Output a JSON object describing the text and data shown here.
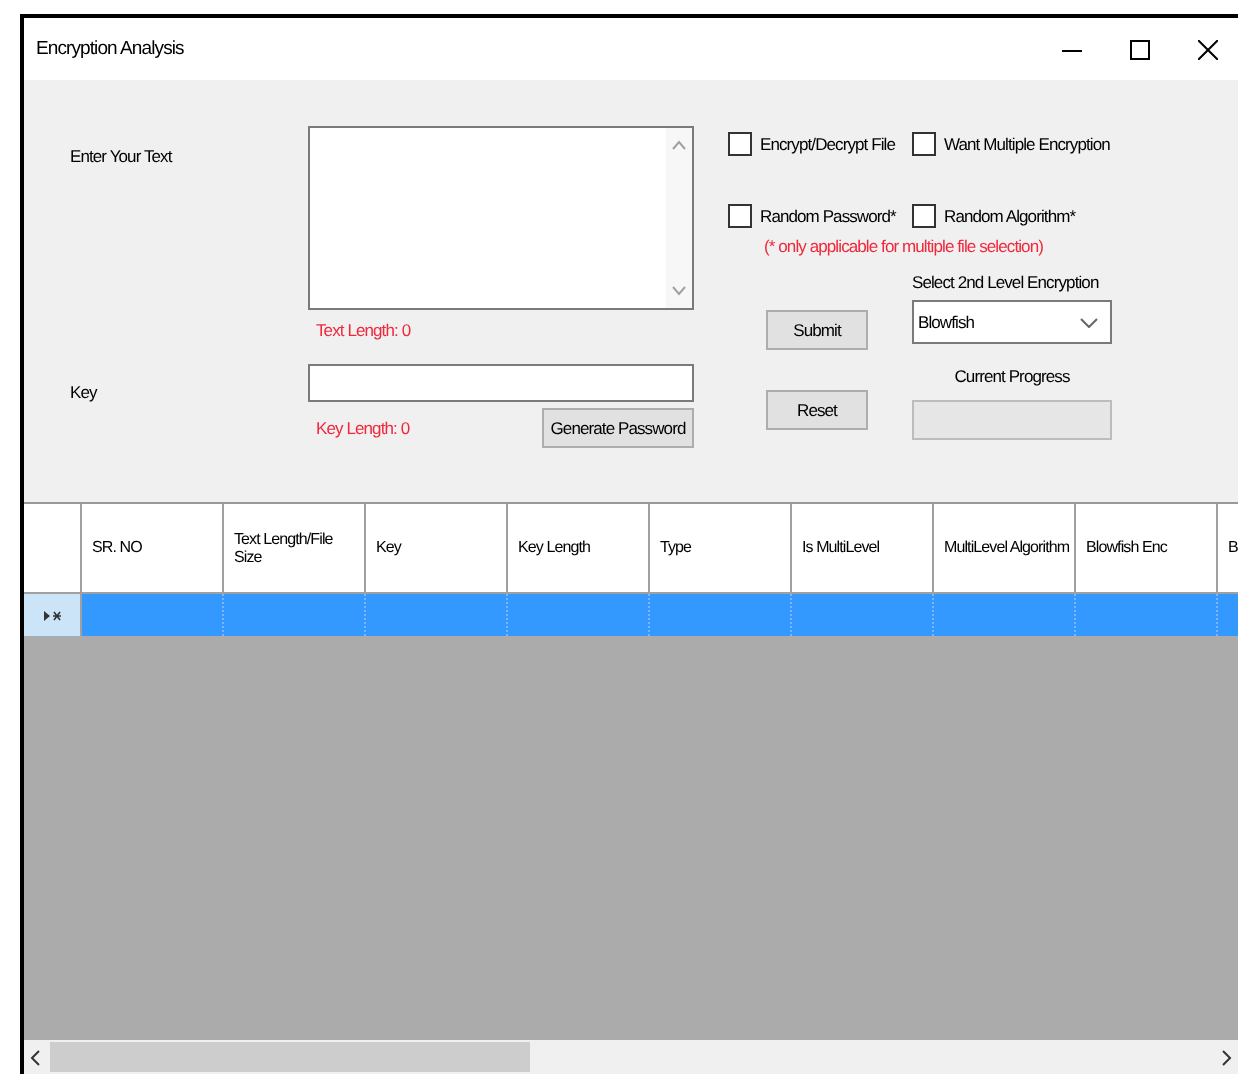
{
  "window": {
    "title": "Encryption Analysis"
  },
  "form": {
    "text_label": "Enter Your Text",
    "text_length": "Text Length: 0",
    "key_label": "Key",
    "key_length": "Key Length: 0",
    "generate_button": "Generate Password",
    "checkboxes": [
      {
        "label": "Encrypt/Decrypt File",
        "checked": false
      },
      {
        "label": "Want Multiple Encryption",
        "checked": false
      },
      {
        "label": "Random Password*",
        "checked": false
      },
      {
        "label": "Random Algorithm*",
        "checked": false
      }
    ],
    "note": "(* only applicable for multiple file selection)",
    "select_label": "Select 2nd Level Encryption",
    "select_value": "Blowfish",
    "submit_button": "Submit",
    "reset_button": "Reset",
    "progress_label": "Current Progress",
    "progress": {
      "level": 0
    }
  },
  "table": {
    "columns": [
      "SR. NO",
      "Text Length/File Size",
      "Key",
      "Key Length",
      "Type",
      "Is MultiLevel",
      "MultiLevel Algorithm",
      "Blowfish Enc",
      "B"
    ],
    "rows": [
      {
        "selected": true
      }
    ]
  }
}
